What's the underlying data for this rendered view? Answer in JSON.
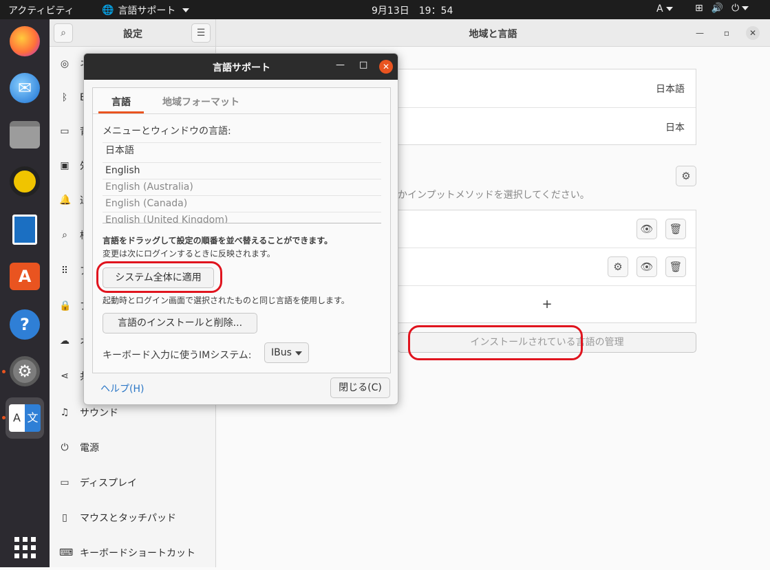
{
  "topbar": {
    "activities": "アクティビティ",
    "app_menu": "言語サポート",
    "clock": "9月13日　19：54",
    "input_indicator": "A"
  },
  "settings": {
    "sidebar_title": "設定",
    "main_title": "地域と言語",
    "sidebar_items": [
      {
        "label": "ネ",
        "icon": "globe-icon"
      },
      {
        "label": "B",
        "icon": "bluetooth-icon"
      },
      {
        "label": "背",
        "icon": "background-icon"
      },
      {
        "label": "外",
        "icon": "appearance-icon"
      },
      {
        "label": "通",
        "icon": "bell-icon"
      },
      {
        "label": "検",
        "icon": "search-icon"
      },
      {
        "label": "ア",
        "icon": "apps-icon"
      },
      {
        "label": "プ",
        "icon": "lock-icon"
      },
      {
        "label": "オ",
        "icon": "cloud-icon"
      },
      {
        "label": "共",
        "icon": "share-icon"
      },
      {
        "label": "サウンド",
        "icon": "music-note-icon"
      },
      {
        "label": "電源",
        "icon": "power-icon"
      },
      {
        "label": "ディスプレイ",
        "icon": "display-icon"
      },
      {
        "label": "マウスとタッチパッド",
        "icon": "mouse-icon"
      },
      {
        "label": "キーボードショートカット",
        "icon": "keyboard-icon"
      }
    ],
    "language_value": "日本語",
    "formats_value": "日本",
    "input_hint": "かインプットメソッドを選択してください。",
    "add_button": "+",
    "manage_languages_button": "インストールされている言語の管理"
  },
  "dialog": {
    "title": "言語サポート",
    "tabs": [
      "言語",
      "地域フォーマット"
    ],
    "menu_lang_label": "メニューとウィンドウの言語:",
    "languages": [
      {
        "name": "日本語",
        "enabled": true
      },
      {
        "name": "English",
        "enabled": true
      },
      {
        "name": "English (Australia)",
        "enabled": false
      },
      {
        "name": "English (Canada)",
        "enabled": false
      },
      {
        "name": "English (United Kingdom)",
        "enabled": false
      }
    ],
    "drag_hint": "言語をドラッグして設定の順番を並べ替えることができます。",
    "relogin_hint": "変更は次にログインするときに反映されます。",
    "apply_system_button": "システム全体に適用",
    "apply_hint": "起動時とログイン画面で選択されたものと同じ言語を使用します。",
    "install_remove_button": "言語のインストールと削除...",
    "im_label": "キーボード入力に使うIMシステム:",
    "im_value": "IBus",
    "help_link": "ヘルプ(H)",
    "close_button": "閉じる(C)"
  },
  "colors": {
    "accent": "#e95420",
    "highlight": "#e0141e"
  }
}
